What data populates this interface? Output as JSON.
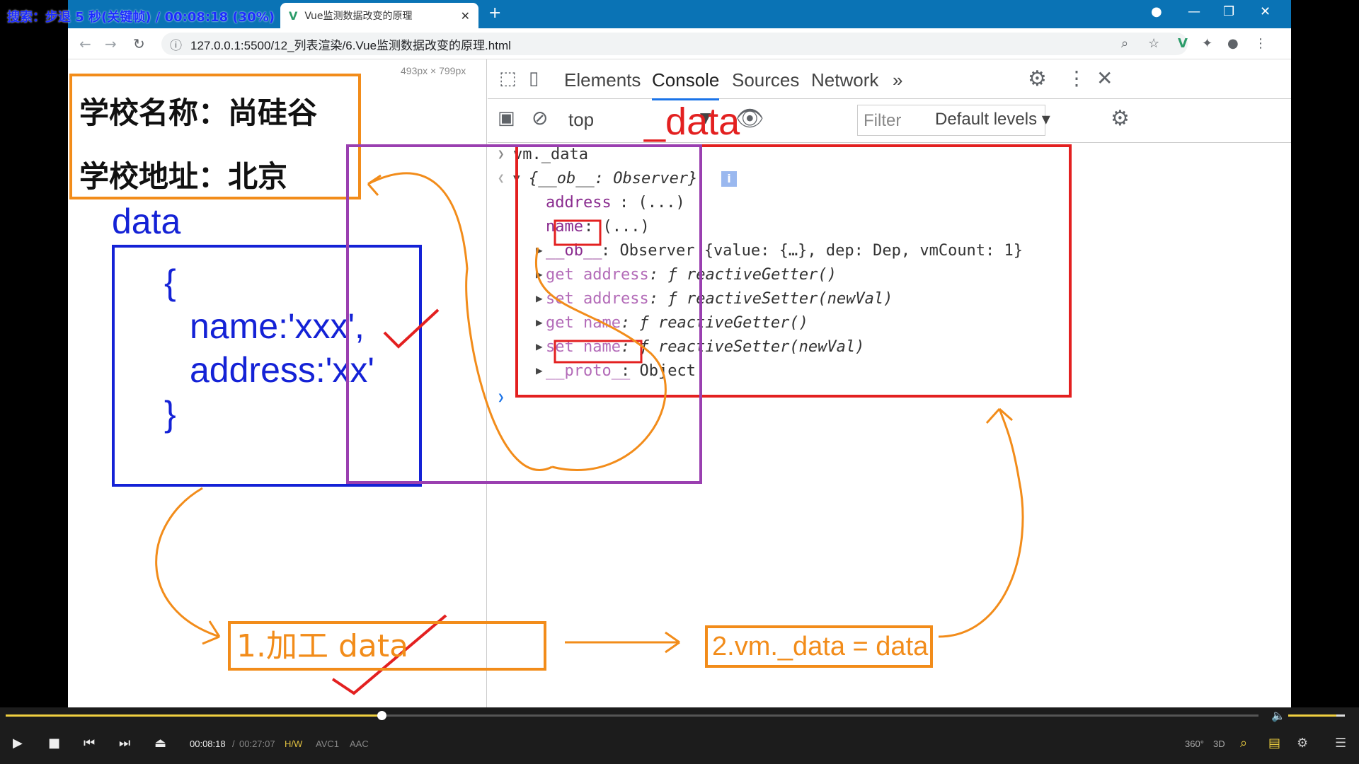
{
  "osd": {
    "text": "搜索：步退 5 秒(关键帧)  / 00:08:18 (30%)"
  },
  "browser": {
    "tab_title": "Vue监测数据改变的原理",
    "url": "127.0.0.1:5500/12_列表渲染/6.Vue监测数据改变的原理.html",
    "viewport_size": "493px × 799px"
  },
  "page": {
    "school_name": "学校名称：尚硅谷",
    "school_address": "学校地址：北京",
    "data_label": "data",
    "code_open": "{",
    "code_name": "name:'xxx',",
    "code_address": "address:'xx'",
    "code_close": "}"
  },
  "devtools": {
    "tabs": [
      "Elements",
      "Console",
      "Sources",
      "Network"
    ],
    "more": "»",
    "context": "top",
    "filter_placeholder": "Filter",
    "levels": "Default levels",
    "console": {
      "input": "vm._data",
      "obj_header": "{__ob__: Observer}",
      "prop_address": "address",
      "prop_address_val": ": (...)",
      "prop_name": "name",
      "prop_name_val": ": (...)",
      "ob_line_key": "__ob__",
      "ob_line_val": ": Observer {value: {…}, dep: Dep, vmCount: 1}",
      "get_address_key": "get address",
      "get_address_val": ": ƒ reactiveGetter()",
      "set_address_key": "set address",
      "set_address_val": ": ƒ reactiveSetter(newVal)",
      "get_name_key": "get name",
      "get_name_val": ": ƒ reactiveGetter()",
      "set_name_key": "set name",
      "set_name_val": ": ƒ reactiveSetter(newVal)",
      "proto_key": "__proto__",
      "proto_val": ": Object"
    }
  },
  "annotations": {
    "underscore_data": "_data",
    "step1": "1.加工 data",
    "step2": "2.vm._data = data"
  },
  "player": {
    "time_current": "00:08:18",
    "time_sep": "/",
    "time_total": "00:27:07",
    "hw": "H/W",
    "vcodec": "AVC1",
    "acodec": "AAC",
    "progress": 0.3,
    "volume": 0.85,
    "btn_360": "360°",
    "btn_3d": "3D"
  },
  "colors": {
    "orange": "#f28c1a",
    "red": "#e32020",
    "purple": "#9a3fb0",
    "blue": "#1422d6"
  }
}
